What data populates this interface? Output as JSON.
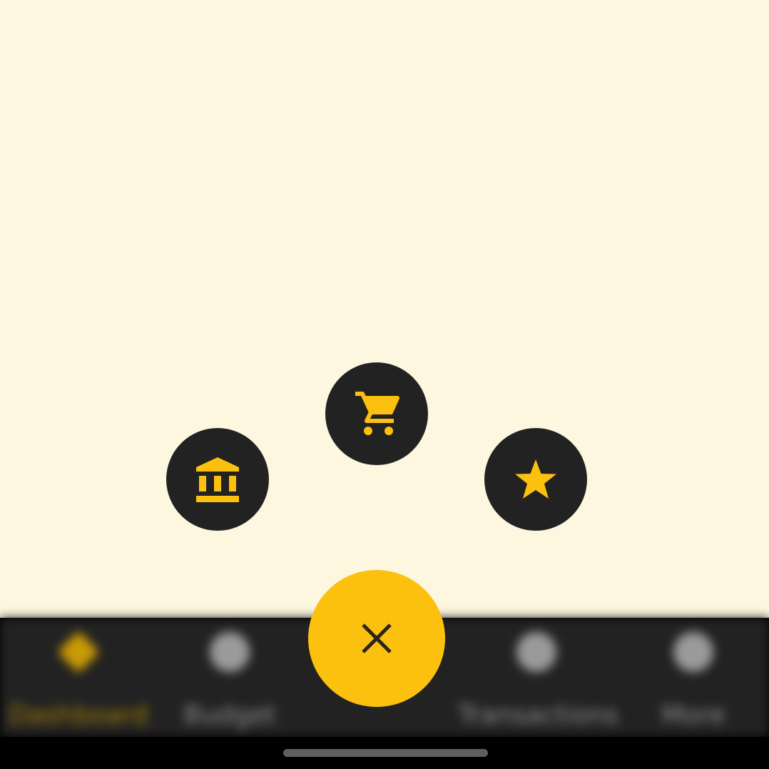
{
  "colors": {
    "background": "#fdf7e0",
    "accent": "#fcc00e",
    "fab_dark": "#222222",
    "nav_background": "#222222"
  },
  "speed_dial": {
    "actions": [
      {
        "icon": "bank-icon"
      },
      {
        "icon": "shopping-cart-icon"
      },
      {
        "icon": "star-icon"
      }
    ],
    "main_icon": "close-icon"
  },
  "bottom_nav": {
    "items": [
      {
        "label": "Dashboard",
        "icon": "home-icon",
        "active": true
      },
      {
        "label": "Budget",
        "icon": "budget-icon",
        "active": false
      },
      {
        "label": "Transactions",
        "icon": "transactions-icon",
        "active": false
      },
      {
        "label": "More",
        "icon": "more-icon",
        "active": false
      }
    ]
  }
}
